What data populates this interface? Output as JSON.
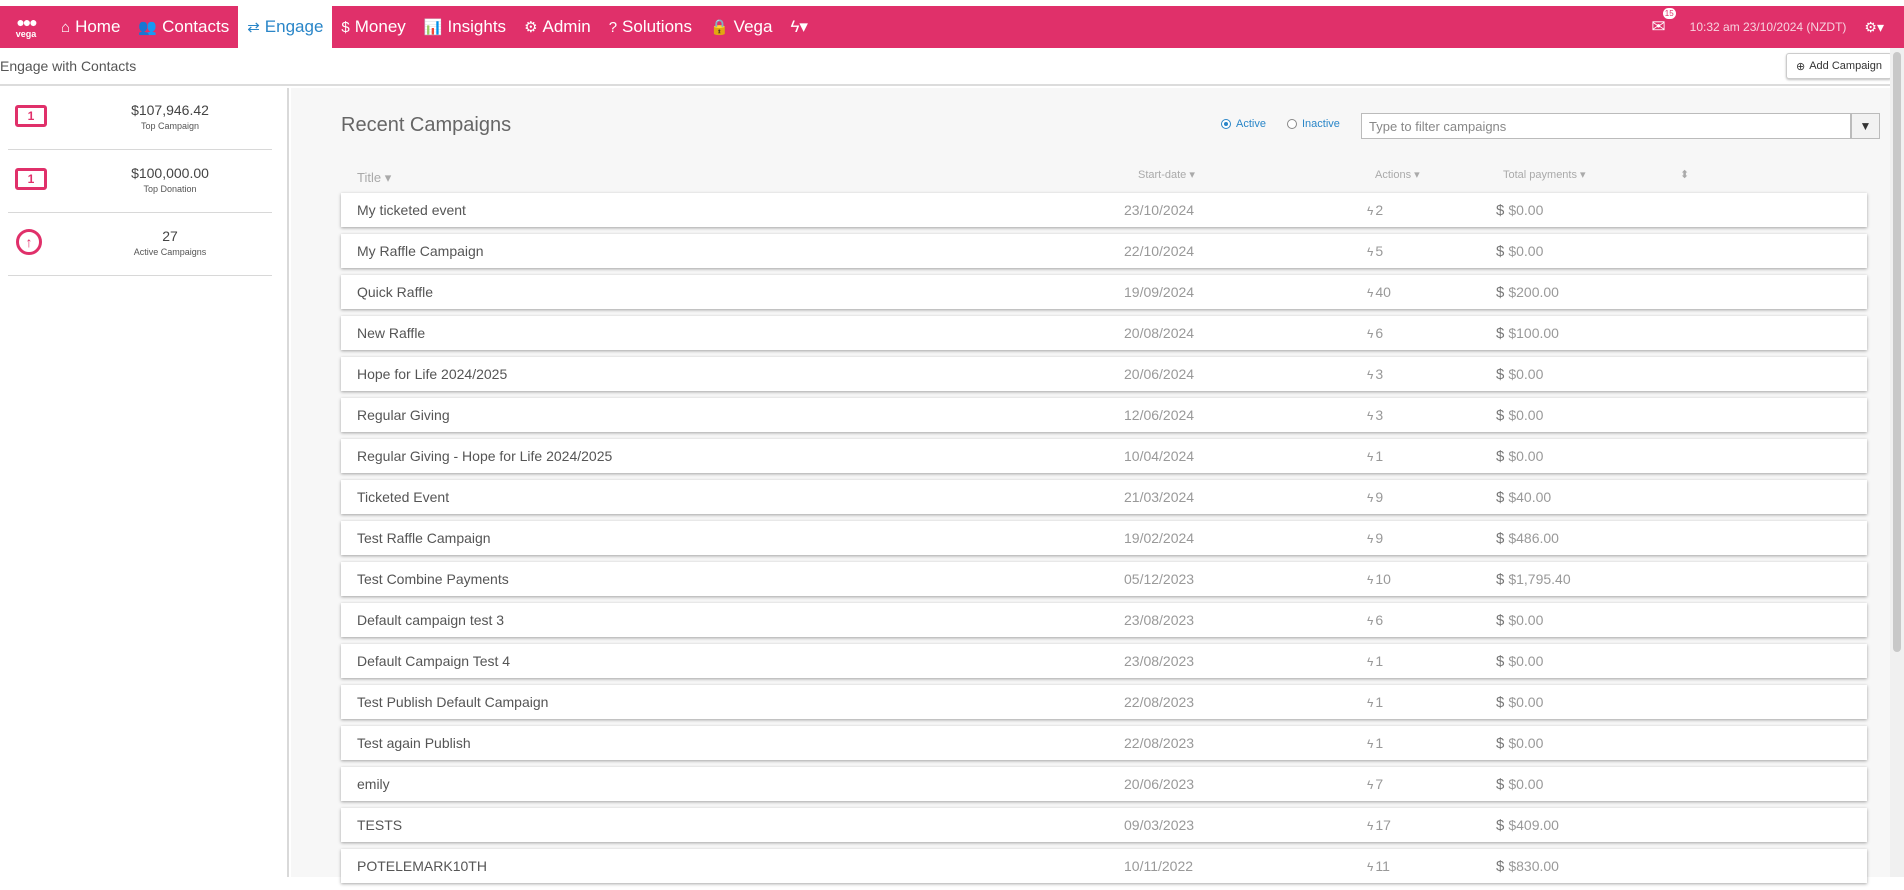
{
  "nav": {
    "brand": "vega",
    "items": [
      {
        "label": "Home",
        "icon": "home-icon",
        "glyph": "⌂"
      },
      {
        "label": "Contacts",
        "icon": "users-icon",
        "glyph": "👥"
      },
      {
        "label": "Engage",
        "icon": "exchange-icon",
        "glyph": "⇄"
      },
      {
        "label": "Money",
        "icon": "dollar-icon",
        "glyph": "$"
      },
      {
        "label": "Insights",
        "icon": "bar-chart-icon",
        "glyph": "📊"
      },
      {
        "label": "Admin",
        "icon": "cogs-icon",
        "glyph": "⚙"
      },
      {
        "label": "Solutions",
        "icon": "question-circle-icon",
        "glyph": "?"
      },
      {
        "label": "Vega",
        "icon": "lock-icon",
        "glyph": "🔒"
      }
    ],
    "quick_glyph": "ϟ▾",
    "mail_badge": "15",
    "clock": "10:32 am 23/10/2024 (NZDT)",
    "settings_glyph": "⚙▾",
    "accent": "#e0306a",
    "active_color": "#2a86c8"
  },
  "subheader": {
    "title": "Engage with Contacts",
    "add_campaign_label": "Add Campaign"
  },
  "sidebar": {
    "stats": [
      {
        "value": "$107,946.42",
        "label": "Top Campaign",
        "icon": "money-bill-icon"
      },
      {
        "value": "$100,000.00",
        "label": "Top Donation",
        "icon": "money-bill-icon"
      },
      {
        "value": "27",
        "label": "Active Campaigns",
        "icon": "arrow-circle-up-icon"
      }
    ]
  },
  "main": {
    "heading": "Recent Campaigns",
    "filter_active": "Active",
    "filter_inactive": "Inactive",
    "filter_placeholder": "Type to filter campaigns",
    "columns": {
      "title": "Title ▾",
      "start_date": "Start-date ▾",
      "actions": "Actions ▾",
      "total_payments": "Total payments ▾",
      "sort": "⬍"
    },
    "rows": [
      {
        "title": "My ticketed event",
        "date": "23/10/2024",
        "actions": "2",
        "payments": "$0.00"
      },
      {
        "title": "My Raffle Campaign",
        "date": "22/10/2024",
        "actions": "5",
        "payments": "$0.00"
      },
      {
        "title": "Quick Raffle",
        "date": "19/09/2024",
        "actions": "40",
        "payments": "$200.00"
      },
      {
        "title": "New Raffle",
        "date": "20/08/2024",
        "actions": "6",
        "payments": "$100.00"
      },
      {
        "title": "Hope for Life 2024/2025",
        "date": "20/06/2024",
        "actions": "3",
        "payments": "$0.00"
      },
      {
        "title": "Regular Giving",
        "date": "12/06/2024",
        "actions": "3",
        "payments": "$0.00"
      },
      {
        "title": "Regular Giving - Hope for Life 2024/2025",
        "date": "10/04/2024",
        "actions": "1",
        "payments": "$0.00"
      },
      {
        "title": "Ticketed Event",
        "date": "21/03/2024",
        "actions": "9",
        "payments": "$40.00"
      },
      {
        "title": "Test Raffle Campaign",
        "date": "19/02/2024",
        "actions": "9",
        "payments": "$486.00"
      },
      {
        "title": "Test Combine Payments",
        "date": "05/12/2023",
        "actions": "10",
        "payments": "$1,795.40"
      },
      {
        "title": "Default campaign test 3",
        "date": "23/08/2023",
        "actions": "6",
        "payments": "$0.00"
      },
      {
        "title": "Default Campaign Test 4",
        "date": "23/08/2023",
        "actions": "1",
        "payments": "$0.00"
      },
      {
        "title": "Test Publish Default Campaign",
        "date": "22/08/2023",
        "actions": "1",
        "payments": "$0.00"
      },
      {
        "title": "Test again Publish",
        "date": "22/08/2023",
        "actions": "1",
        "payments": "$0.00"
      },
      {
        "title": "emily",
        "date": "20/06/2023",
        "actions": "7",
        "payments": "$0.00"
      },
      {
        "title": "TESTS",
        "date": "09/03/2023",
        "actions": "17",
        "payments": "$409.00"
      },
      {
        "title": "POTELEMARK10TH",
        "date": "10/11/2022",
        "actions": "11",
        "payments": "$830.00"
      }
    ]
  }
}
